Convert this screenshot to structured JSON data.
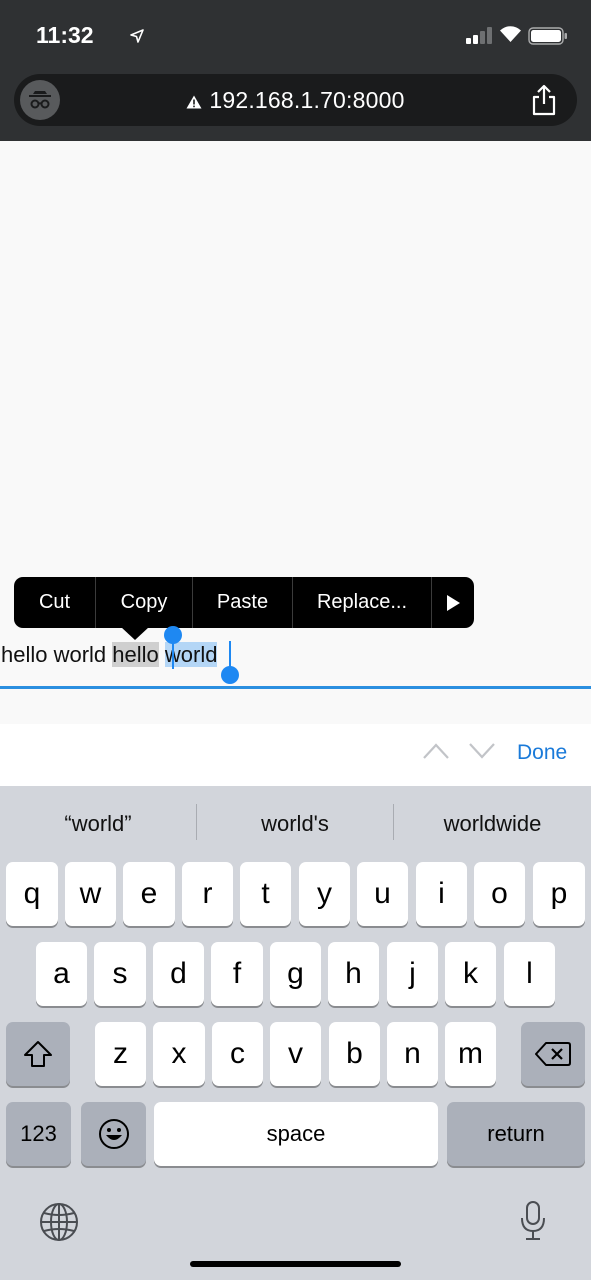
{
  "status_bar": {
    "time": "11:32"
  },
  "browser": {
    "url": "192.168.1.70:8000"
  },
  "edit_menu": {
    "items": [
      "Cut",
      "Copy",
      "Paste",
      "Replace..."
    ]
  },
  "text_field": {
    "part1": "hello world ",
    "part2": "hello",
    "part3": " ",
    "selected": "world"
  },
  "accessory": {
    "done_label": "Done"
  },
  "suggestions": [
    "“world”",
    "world's",
    "worldwide"
  ],
  "keyboard": {
    "row1": [
      "q",
      "w",
      "e",
      "r",
      "t",
      "y",
      "u",
      "i",
      "o",
      "p"
    ],
    "row2": [
      "a",
      "s",
      "d",
      "f",
      "g",
      "h",
      "j",
      "k",
      "l"
    ],
    "row3": [
      "z",
      "x",
      "c",
      "v",
      "b",
      "n",
      "m"
    ],
    "numbers_key": "123",
    "space_key": "space",
    "return_key": "return"
  },
  "colors": {
    "selection": "#b4d6f6",
    "accent": "#1a7ad9",
    "chrome": "#2f3133"
  }
}
